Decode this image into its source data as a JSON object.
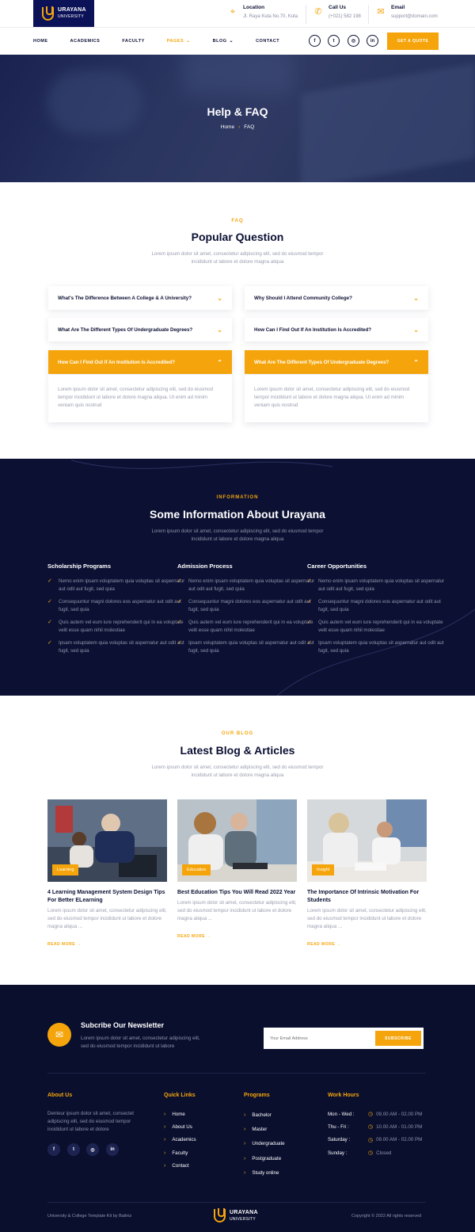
{
  "brand": {
    "name": "URAYANA",
    "sub": "UNIVERSITY"
  },
  "topbar": {
    "location": {
      "label": "Location",
      "value": "Jl. Raya Kuta No.70, Kuta"
    },
    "call": {
      "label": "Call Us",
      "value": "(+021) 582 198"
    },
    "email": {
      "label": "Email",
      "value": "support@domain.com"
    }
  },
  "nav": {
    "home": "HOME",
    "academics": "ACADEMICS",
    "faculty": "FACULTY",
    "pages": "PAGES",
    "blog": "BLOG",
    "contact": "CONTACT",
    "quote": "GET A QUOTE"
  },
  "social": {
    "facebook": "f",
    "twitter": "t",
    "instagram": "◎",
    "linkedin": "in"
  },
  "hero": {
    "title": "Help & FAQ",
    "crumb_home": "Home",
    "crumb_current": "FAQ"
  },
  "faq": {
    "eyebrow": "FAQ",
    "title": "Popular Question",
    "subtitle": "Lorem ipsum dolor sit amet, consectetur adipiscing elit, sed do eiusmod tempor incididunt ut labore et dolore magna aliqua",
    "left": [
      "What's The Difference Between A College & A University?",
      "What Are The Different Types Of Undergraduate Degrees?",
      "How Can I Find Out If An Institution Is Accredited?"
    ],
    "right": [
      "Why Should I Attend Community College?",
      "How Can I Find Out If An Institution Is Accredited?",
      "What Are The Different Types Of Undergraduate Degrees?"
    ],
    "answer": "Lorem ipsum dolor sit amet, consectetur adipiscing elit, sed do eiusmod tempor incididunt ut labore et dolore magna aliqua. Ut enim ad minim veniam quis nostrud"
  },
  "info": {
    "eyebrow": "INFORMATION",
    "title": "Some Information About Urayana",
    "subtitle": "Lorem ipsum dolor sit amet, consectetur adipiscing elit, sed do eiusmod tempor incididunt ut labore et dolore magna aliqua",
    "columns": [
      {
        "title": "Scholarship Programs",
        "items": [
          "Nemo enim ipsam voluptatem quia voluptas sit aspernatur aut odit aut fugit, sed quia",
          "Consequuntur magni dolores eos aspernatur aut odit aut fugit, sed quia",
          "Quis autem vel eum iure reprehenderit qui in ea voluptate velit esse quam nihil molestiae",
          "Ipsam voluptatem quia voluptas sit aspernatur aut odit aut fugit, sed quia"
        ]
      },
      {
        "title": "Admission Process",
        "items": [
          "Nemo enim ipsam voluptatem quia voluptas sit aspernatur aut odit aut fugit, sed quia",
          "Consequuntur magni dolores eos aspernatur aut odit aut fugit, sed quia",
          "Quis autem vel eum iure reprehenderit qui in ea voluptate velit esse quam nihil molestiae",
          "Ipsam voluptatem quia voluptas sit aspernatur aut odit aut fugit, sed quia"
        ]
      },
      {
        "title": "Career Opportunities",
        "items": [
          "Nemo enim ipsam voluptatem quia voluptas sit aspernatur aut odit aut fugit, sed quia",
          "Consequuntur magni dolores eos aspernatur aut odit aut fugit, sed quia",
          "Quis autem vel eum iure reprehenderit qui in ea voluptate velit esse quam nihil molestiae",
          "Ipsam voluptatem quia voluptas sit aspernatur aut odit aut fugit, sed quia"
        ]
      }
    ]
  },
  "blog": {
    "eyebrow": "OUR BLOG",
    "title": "Latest Blog & Articles",
    "subtitle": "Lorem ipsum dolor sit amet, consectetur adipiscing elit, sed do eiusmod tempor incididunt ut labore et dolore magna aliqua",
    "posts": [
      {
        "tag": "Learning",
        "title": "4 Learning Management System Design Tips For Better ELearning",
        "excerpt": "Lorem ipsum dolor sit amet, consectetur adipiscing elit, sed do eiusmod tempor incididunt ut labore et dolore magna aliqua ...",
        "more": "READ MORE"
      },
      {
        "tag": "Education",
        "title": "Best Education Tips You Will Read 2022 Year",
        "excerpt": "Lorem ipsum dolor sit amet, consectetur adipiscing elit, sed do eiusmod tempor incididunt ut labore et dolore magna aliqua ...",
        "more": "READ MORE"
      },
      {
        "tag": "Insight",
        "title": "The Importance Of Intrinsic Motivation For Students",
        "excerpt": "Lorem ipsum dolor sit amet, consectetur adipiscing elit, sed do eiusmod tempor incididunt ut labore et dolore magna aliqua ...",
        "more": "READ MORE"
      }
    ]
  },
  "footer": {
    "newsletter": {
      "title": "Subcribe Our Newsletter",
      "subtitle": "Lorem ipsum dolor sit amet, consectetur adipiscing elit, sed do eiusmod tempor incididunt ut labore",
      "placeholder": "Your Email Address",
      "button": "SUBSCRIBE"
    },
    "about": {
      "title": "About Us",
      "text": "Denteur ipsum dolor sit amet, consectet adipiscing elit, sed do eiusmod tempor incididunt ut labore et dolore"
    },
    "quick": {
      "title": "Quick Links",
      "items": [
        "Home",
        "About Us",
        "Academics",
        "Faculty",
        "Contact"
      ]
    },
    "programs": {
      "title": "Programs",
      "items": [
        "Bachelor",
        "Master",
        "Undergraduate",
        "Postgraduate",
        "Study online"
      ]
    },
    "hours": {
      "title": "Work Hours",
      "rows": [
        {
          "day": "Mon - Wed :",
          "time": "09.00 AM - 02.00 PM"
        },
        {
          "day": "Thu - Fri :",
          "time": "10.00 AM - 01.00 PM"
        },
        {
          "day": "Saturday :",
          "time": "09.00 AM - 02.00 PM"
        },
        {
          "day": "Sunday :",
          "time": "Closed"
        }
      ]
    },
    "credit": "University & College Template Kit by Baliniz",
    "copyright": "Copyright © 2022 All rights reserved"
  },
  "colors": {
    "accent": "#f5a50b",
    "navy": "#0c1133",
    "brand": "#0c1257"
  }
}
